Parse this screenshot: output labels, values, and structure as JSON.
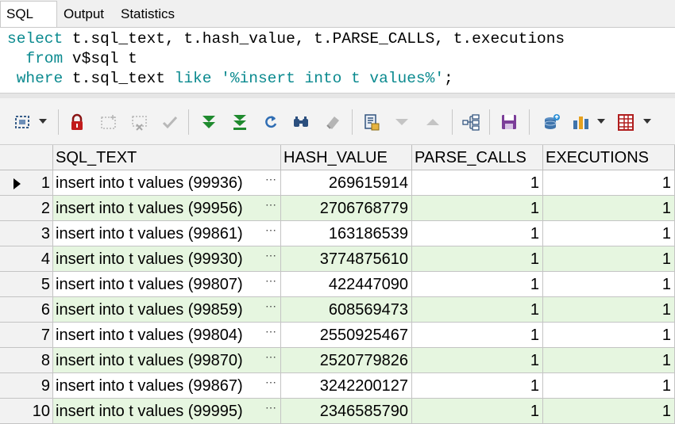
{
  "tabs": [
    {
      "label": "SQL",
      "active": true
    },
    {
      "label": "Output",
      "active": false
    },
    {
      "label": "Statistics",
      "active": false
    }
  ],
  "editor": {
    "line1": {
      "kw1": "select",
      "rest": " t.sql_text, t.hash_value, t.PARSE_CALLS, t.executions"
    },
    "line2": {
      "indent": "  ",
      "kw": "from",
      "rest": " v$sql t"
    },
    "line3": {
      "indent": " ",
      "kw": "where",
      "mid": " t.sql_text ",
      "kw2": "like",
      "sp": " ",
      "str": "'%insert into t values%'",
      "end": ";"
    }
  },
  "toolbar": {
    "icons": [
      "select-grid-icon",
      "lock-icon",
      "insert-record-icon",
      "delete-record-icon",
      "post-record-icon",
      "fetch-next-icon",
      "fetch-last-icon",
      "refresh-icon",
      "find-icon",
      "clear-icon",
      "query-by-example-icon",
      "next-page-icon",
      "previous-page-icon",
      "single-record-view-icon",
      "save-icon",
      "export-icon",
      "chart-icon",
      "grid-options-icon"
    ]
  },
  "grid": {
    "columns": [
      "SQL_TEXT",
      "HASH_VALUE",
      "PARSE_CALLS",
      "EXECUTIONS"
    ],
    "rows": [
      {
        "n": "1",
        "sql_text": "insert into t values (99936)",
        "hash_value": "269615914",
        "parse_calls": "1",
        "executions": "1"
      },
      {
        "n": "2",
        "sql_text": "insert into t values (99956)",
        "hash_value": "2706768779",
        "parse_calls": "1",
        "executions": "1"
      },
      {
        "n": "3",
        "sql_text": "insert into t values (99861)",
        "hash_value": "163186539",
        "parse_calls": "1",
        "executions": "1"
      },
      {
        "n": "4",
        "sql_text": "insert into t values (99930)",
        "hash_value": "3774875610",
        "parse_calls": "1",
        "executions": "1"
      },
      {
        "n": "5",
        "sql_text": "insert into t values (99807)",
        "hash_value": "422447090",
        "parse_calls": "1",
        "executions": "1"
      },
      {
        "n": "6",
        "sql_text": "insert into t values (99859)",
        "hash_value": "608569473",
        "parse_calls": "1",
        "executions": "1"
      },
      {
        "n": "7",
        "sql_text": "insert into t values (99804)",
        "hash_value": "2550925467",
        "parse_calls": "1",
        "executions": "1"
      },
      {
        "n": "8",
        "sql_text": "insert into t values (99870)",
        "hash_value": "2520779826",
        "parse_calls": "1",
        "executions": "1"
      },
      {
        "n": "9",
        "sql_text": "insert into t values (99867)",
        "hash_value": "3242200127",
        "parse_calls": "1",
        "executions": "1"
      },
      {
        "n": "10",
        "sql_text": "insert into t values (99995)",
        "hash_value": "2346585790",
        "parse_calls": "1",
        "executions": "1"
      }
    ],
    "ellipsis": "⋯",
    "colors": {
      "alt_row": "#e6f6e0",
      "keyword": "#0b8a8f"
    }
  }
}
